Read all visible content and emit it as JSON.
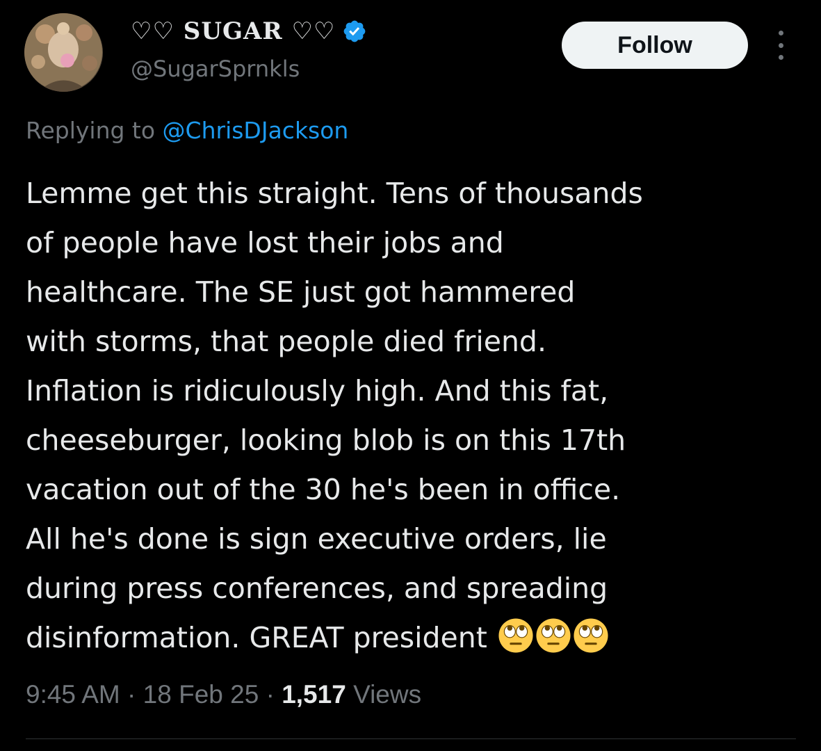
{
  "author": {
    "display_name": "♡♡ SUGAR ♡♡",
    "handle": "@SugarSprnkls",
    "verified": true
  },
  "actions": {
    "follow_label": "Follow"
  },
  "reply": {
    "prefix": "Replying to ",
    "mention": "@ChrisDJackson"
  },
  "tweet": {
    "lines": [
      "Lemme get this straight. Tens of thousands",
      "of people have lost their jobs and",
      "healthcare. The SE just got hammered",
      "with storms, that people died friend.",
      "Inflation is ridiculously high. And this fat,",
      "cheeseburger, looking blob is on this 17th",
      "vacation out of the 30 he's been in office.",
      "All he's done is sign executive orders, lie",
      "during press conferences, and spreading",
      "disinformation. GREAT president"
    ],
    "trailing_emoji": [
      "face-with-rolling-eyes-icon",
      "face-with-rolling-eyes-icon",
      "face-with-rolling-eyes-icon"
    ]
  },
  "meta": {
    "time": "9:45 AM",
    "date": "18 Feb 25",
    "views_count": "1,517",
    "views_label": "Views",
    "separator": " · "
  },
  "colors": {
    "background": "#000000",
    "text_primary": "#e7e9ea",
    "text_secondary": "#71767b",
    "accent": "#1d9bf0",
    "follow_bg": "#eff3f4"
  }
}
